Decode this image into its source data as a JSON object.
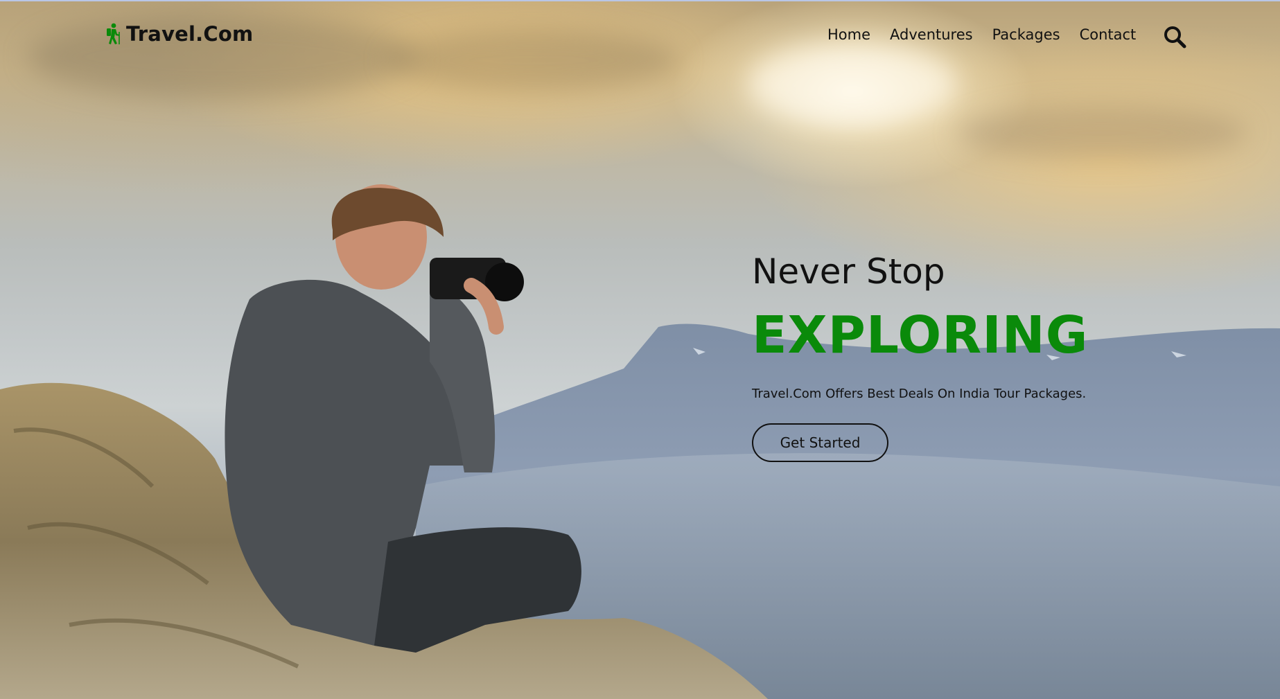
{
  "header": {
    "brand": "Travel.Com",
    "brand_icon": "hiker-icon",
    "nav": [
      {
        "label": "Home"
      },
      {
        "label": "Adventures"
      },
      {
        "label": "Packages"
      },
      {
        "label": "Contact"
      }
    ],
    "search_icon": "search-icon"
  },
  "hero": {
    "subtitle": "Never Stop",
    "title": "EXPLORING",
    "description": "Travel.Com Offers Best Deals On India Tour Packages.",
    "cta_label": "Get Started"
  },
  "colors": {
    "accent": "#0a8a0a",
    "text": "#111111"
  }
}
